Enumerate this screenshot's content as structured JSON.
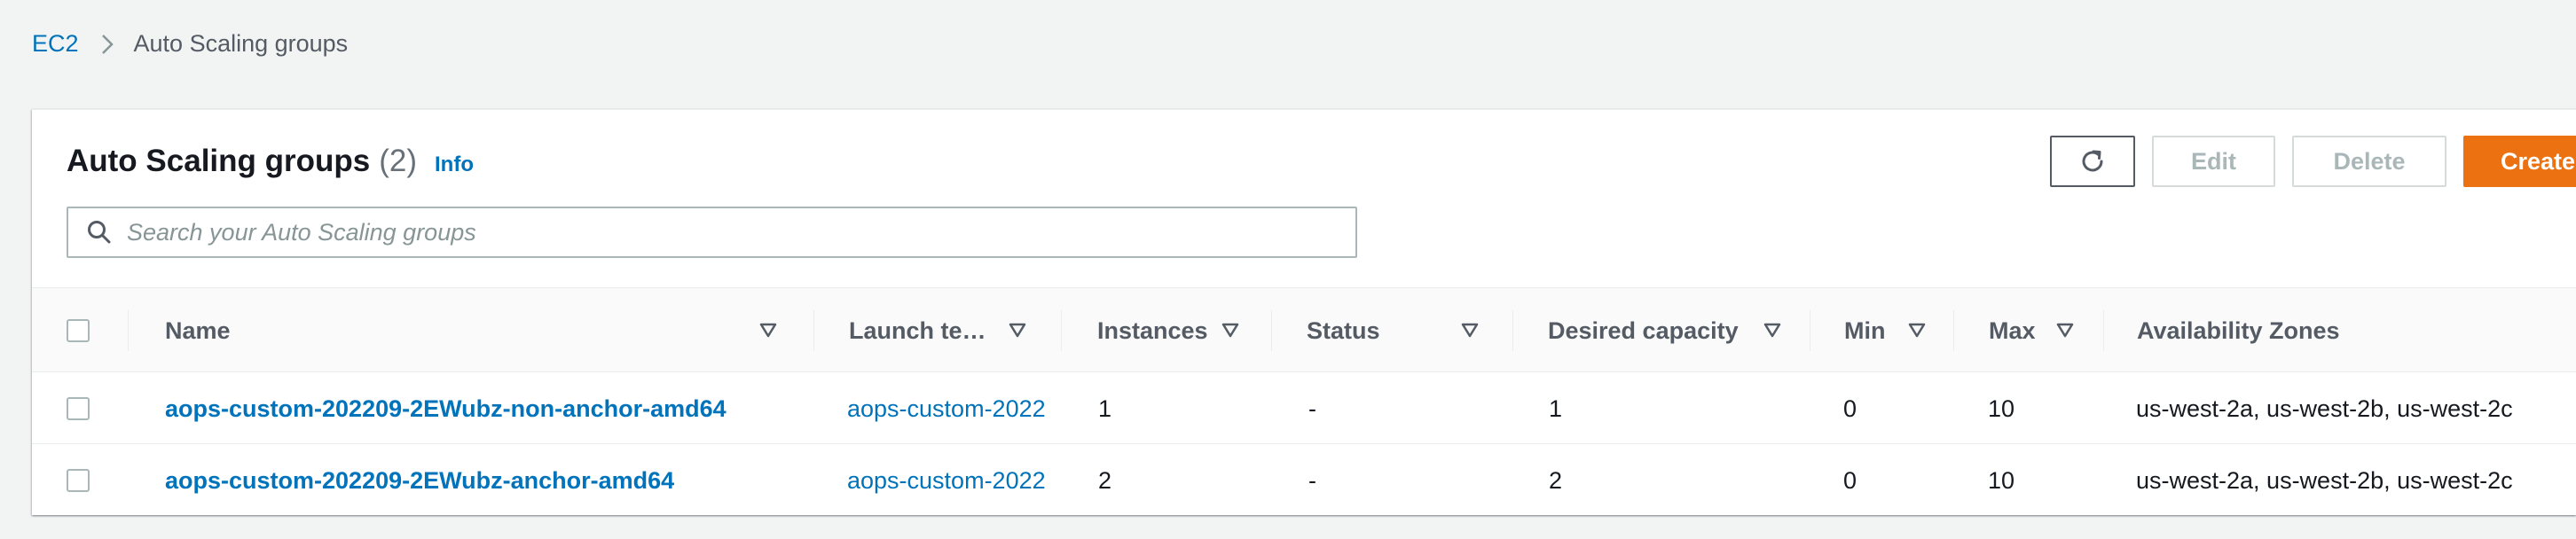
{
  "breadcrumb": {
    "root": "EC2",
    "current": "Auto Scaling groups"
  },
  "panel": {
    "title": "Auto Scaling groups",
    "count": "(2)",
    "info_label": "Info"
  },
  "toolbar": {
    "refresh_icon": "refresh-icon",
    "edit_label": "Edit",
    "delete_label": "Delete",
    "create_label": "Create"
  },
  "search": {
    "placeholder": "Search your Auto Scaling groups",
    "value": ""
  },
  "table": {
    "columns": [
      "Name",
      "Launch te…",
      "Instances",
      "Status",
      "Desired capacity",
      "Min",
      "Max",
      "Availability Zones"
    ],
    "rows": [
      {
        "name": "aops-custom-202209-2EWubz-non-anchor-amd64",
        "launch_template": "aops-custom-2022",
        "instances": "1",
        "status": "-",
        "desired_capacity": "1",
        "min": "0",
        "max": "10",
        "availability_zones": "us-west-2a, us-west-2b, us-west-2c"
      },
      {
        "name": "aops-custom-202209-2EWubz-anchor-amd64",
        "launch_template": "aops-custom-2022",
        "instances": "2",
        "status": "-",
        "desired_capacity": "2",
        "min": "0",
        "max": "10",
        "availability_zones": "us-west-2a, us-west-2b, us-west-2c"
      }
    ]
  },
  "colors": {
    "link": "#0073bb",
    "primary_button": "#ec7211",
    "background": "#f2f3f3",
    "header_text": "#545b64"
  }
}
